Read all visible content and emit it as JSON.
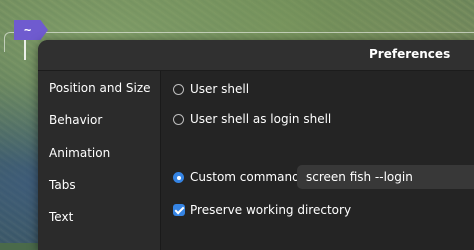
{
  "terminal": {
    "tab_label": "~"
  },
  "dialog": {
    "title": "Preferences",
    "sidebar": {
      "items": [
        {
          "label": "Position and Size"
        },
        {
          "label": "Behavior"
        },
        {
          "label": "Animation"
        },
        {
          "label": "Tabs"
        },
        {
          "label": "Text"
        }
      ]
    },
    "shell": {
      "options": [
        {
          "label": "User shell",
          "selected": false
        },
        {
          "label": "User shell as login shell",
          "selected": false
        },
        {
          "label": "Custom command:",
          "selected": true
        }
      ],
      "custom_command_value": "screen fish --login",
      "preserve_dir": {
        "label": "Preserve working directory",
        "checked": true
      }
    }
  },
  "colors": {
    "accent": "#3584e4",
    "tab_accent": "#6f5bcf",
    "window_bg": "#242424",
    "sidebar_bg": "#2b2b2b"
  }
}
